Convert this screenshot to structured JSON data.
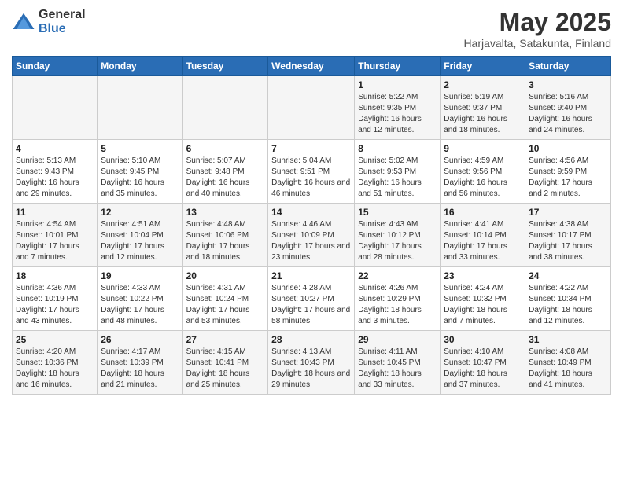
{
  "header": {
    "logo_general": "General",
    "logo_blue": "Blue",
    "title": "May 2025",
    "subtitle": "Harjavalta, Satakunta, Finland"
  },
  "days_of_week": [
    "Sunday",
    "Monday",
    "Tuesday",
    "Wednesday",
    "Thursday",
    "Friday",
    "Saturday"
  ],
  "weeks": [
    [
      {
        "day": "",
        "info": ""
      },
      {
        "day": "",
        "info": ""
      },
      {
        "day": "",
        "info": ""
      },
      {
        "day": "",
        "info": ""
      },
      {
        "day": "1",
        "info": "Sunrise: 5:22 AM\nSunset: 9:35 PM\nDaylight: 16 hours and 12 minutes."
      },
      {
        "day": "2",
        "info": "Sunrise: 5:19 AM\nSunset: 9:37 PM\nDaylight: 16 hours and 18 minutes."
      },
      {
        "day": "3",
        "info": "Sunrise: 5:16 AM\nSunset: 9:40 PM\nDaylight: 16 hours and 24 minutes."
      }
    ],
    [
      {
        "day": "4",
        "info": "Sunrise: 5:13 AM\nSunset: 9:43 PM\nDaylight: 16 hours and 29 minutes."
      },
      {
        "day": "5",
        "info": "Sunrise: 5:10 AM\nSunset: 9:45 PM\nDaylight: 16 hours and 35 minutes."
      },
      {
        "day": "6",
        "info": "Sunrise: 5:07 AM\nSunset: 9:48 PM\nDaylight: 16 hours and 40 minutes."
      },
      {
        "day": "7",
        "info": "Sunrise: 5:04 AM\nSunset: 9:51 PM\nDaylight: 16 hours and 46 minutes."
      },
      {
        "day": "8",
        "info": "Sunrise: 5:02 AM\nSunset: 9:53 PM\nDaylight: 16 hours and 51 minutes."
      },
      {
        "day": "9",
        "info": "Sunrise: 4:59 AM\nSunset: 9:56 PM\nDaylight: 16 hours and 56 minutes."
      },
      {
        "day": "10",
        "info": "Sunrise: 4:56 AM\nSunset: 9:59 PM\nDaylight: 17 hours and 2 minutes."
      }
    ],
    [
      {
        "day": "11",
        "info": "Sunrise: 4:54 AM\nSunset: 10:01 PM\nDaylight: 17 hours and 7 minutes."
      },
      {
        "day": "12",
        "info": "Sunrise: 4:51 AM\nSunset: 10:04 PM\nDaylight: 17 hours and 12 minutes."
      },
      {
        "day": "13",
        "info": "Sunrise: 4:48 AM\nSunset: 10:06 PM\nDaylight: 17 hours and 18 minutes."
      },
      {
        "day": "14",
        "info": "Sunrise: 4:46 AM\nSunset: 10:09 PM\nDaylight: 17 hours and 23 minutes."
      },
      {
        "day": "15",
        "info": "Sunrise: 4:43 AM\nSunset: 10:12 PM\nDaylight: 17 hours and 28 minutes."
      },
      {
        "day": "16",
        "info": "Sunrise: 4:41 AM\nSunset: 10:14 PM\nDaylight: 17 hours and 33 minutes."
      },
      {
        "day": "17",
        "info": "Sunrise: 4:38 AM\nSunset: 10:17 PM\nDaylight: 17 hours and 38 minutes."
      }
    ],
    [
      {
        "day": "18",
        "info": "Sunrise: 4:36 AM\nSunset: 10:19 PM\nDaylight: 17 hours and 43 minutes."
      },
      {
        "day": "19",
        "info": "Sunrise: 4:33 AM\nSunset: 10:22 PM\nDaylight: 17 hours and 48 minutes."
      },
      {
        "day": "20",
        "info": "Sunrise: 4:31 AM\nSunset: 10:24 PM\nDaylight: 17 hours and 53 minutes."
      },
      {
        "day": "21",
        "info": "Sunrise: 4:28 AM\nSunset: 10:27 PM\nDaylight: 17 hours and 58 minutes."
      },
      {
        "day": "22",
        "info": "Sunrise: 4:26 AM\nSunset: 10:29 PM\nDaylight: 18 hours and 3 minutes."
      },
      {
        "day": "23",
        "info": "Sunrise: 4:24 AM\nSunset: 10:32 PM\nDaylight: 18 hours and 7 minutes."
      },
      {
        "day": "24",
        "info": "Sunrise: 4:22 AM\nSunset: 10:34 PM\nDaylight: 18 hours and 12 minutes."
      }
    ],
    [
      {
        "day": "25",
        "info": "Sunrise: 4:20 AM\nSunset: 10:36 PM\nDaylight: 18 hours and 16 minutes."
      },
      {
        "day": "26",
        "info": "Sunrise: 4:17 AM\nSunset: 10:39 PM\nDaylight: 18 hours and 21 minutes."
      },
      {
        "day": "27",
        "info": "Sunrise: 4:15 AM\nSunset: 10:41 PM\nDaylight: 18 hours and 25 minutes."
      },
      {
        "day": "28",
        "info": "Sunrise: 4:13 AM\nSunset: 10:43 PM\nDaylight: 18 hours and 29 minutes."
      },
      {
        "day": "29",
        "info": "Sunrise: 4:11 AM\nSunset: 10:45 PM\nDaylight: 18 hours and 33 minutes."
      },
      {
        "day": "30",
        "info": "Sunrise: 4:10 AM\nSunset: 10:47 PM\nDaylight: 18 hours and 37 minutes."
      },
      {
        "day": "31",
        "info": "Sunrise: 4:08 AM\nSunset: 10:49 PM\nDaylight: 18 hours and 41 minutes."
      }
    ]
  ]
}
